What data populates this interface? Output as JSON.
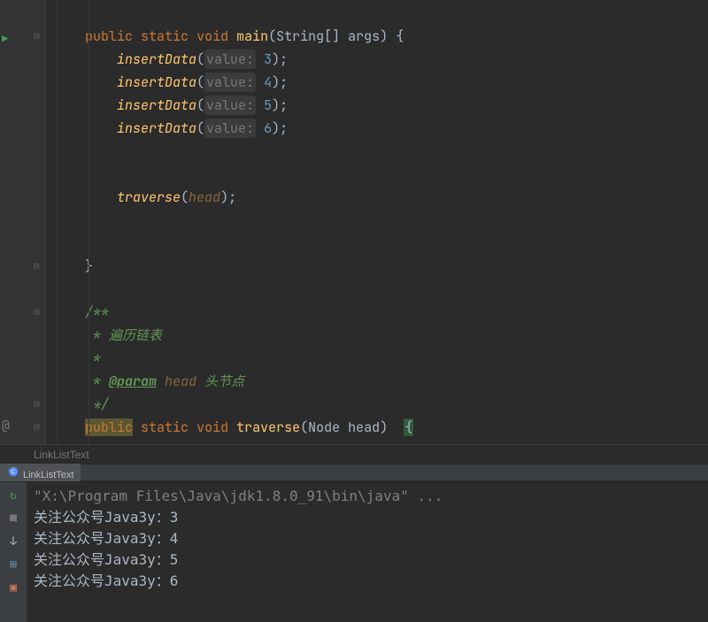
{
  "code": {
    "method_decl": {
      "public": "public",
      "static": "static",
      "void": "void",
      "main": "main",
      "param_type": "String[]",
      "param_name": "args"
    },
    "insert_calls": [
      {
        "fn": "insertData",
        "label": "value:",
        "val": "3"
      },
      {
        "fn": "insertData",
        "label": "value:",
        "val": "4"
      },
      {
        "fn": "insertData",
        "label": "value:",
        "val": "5"
      },
      {
        "fn": "insertData",
        "label": "value:",
        "val": "6"
      }
    ],
    "traverse_call": {
      "fn": "traverse",
      "arg": "head"
    },
    "javadoc": {
      "open": "/**",
      "line1": " * 遍历链表",
      "line_blank": " *",
      "tag": "@param",
      "param": "head",
      "desc": "头节点",
      "line_param_prefix": " * ",
      "close": " */"
    },
    "traverse_decl": {
      "public": "public",
      "static": "static",
      "void": "void",
      "name": "traverse",
      "param_type": "Node",
      "param_name": "head"
    }
  },
  "breadcrumb": {
    "text": "LinkListText"
  },
  "run_tab": {
    "label": "LinkListText"
  },
  "console": {
    "cmd": "\"X:\\Program Files\\Java\\jdk1.8.0_91\\bin\\java\" ...",
    "lines": [
      "关注公众号Java3y：3",
      "关注公众号Java3y：4",
      "关注公众号Java3y：5",
      "关注公众号Java3y：6"
    ]
  }
}
